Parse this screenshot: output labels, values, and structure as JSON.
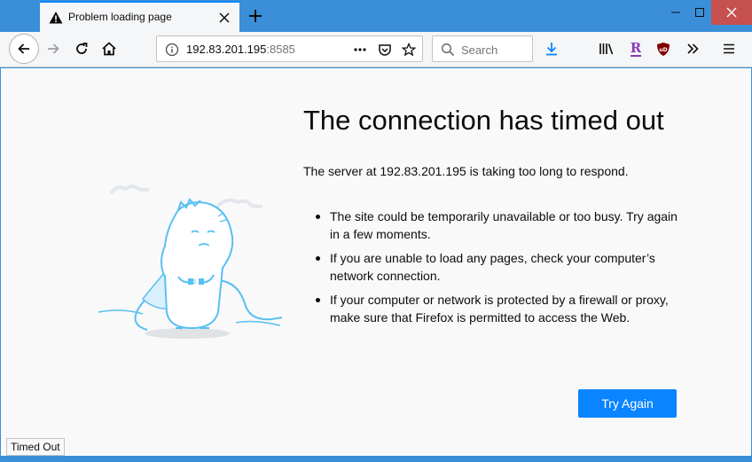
{
  "window": {
    "minimize_icon": "minimize-icon",
    "maximize_icon": "maximize-icon",
    "close_icon": "close-icon"
  },
  "tab": {
    "title": "Problem loading page",
    "icon": "warning-icon"
  },
  "navbar": {
    "url_host": "192.83.201.195",
    "url_port": ":8585",
    "search_placeholder": "Search"
  },
  "error": {
    "title": "The connection has timed out",
    "description": "The server at 192.83.201.195 is taking too long to respond.",
    "bullets": [
      "The site could be temporarily unavailable or too busy. Try again in a few moments.",
      "If you are unable to load any pages, check your computer’s network connection.",
      "If your computer or network is protected by a firewall or proxy, make sure that Firefox is permitted to access the Web."
    ],
    "button_label": "Try Again"
  },
  "status": {
    "text": "Timed Out"
  },
  "colors": {
    "accent": "#0a84ff",
    "titlebar": "#3b8fd8",
    "ublock_red": "#800000",
    "r_purple": "#8a3ab9"
  }
}
